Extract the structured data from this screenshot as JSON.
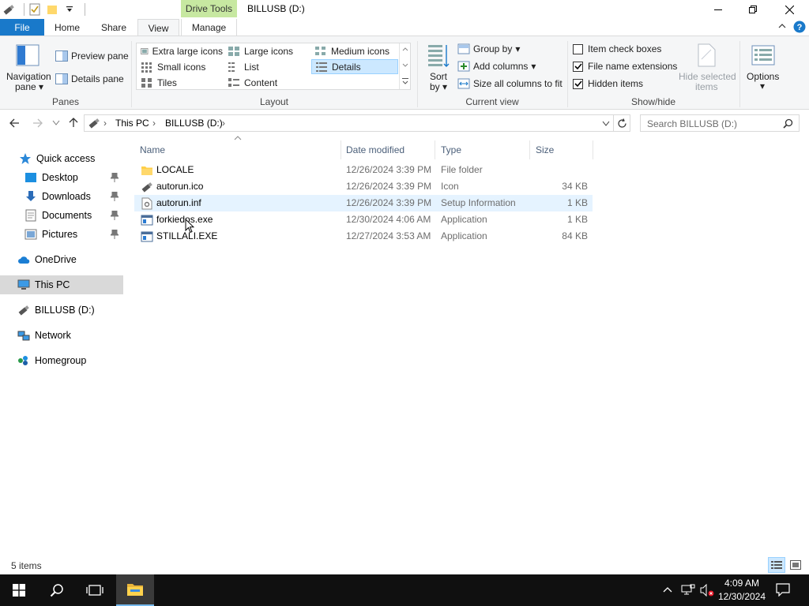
{
  "window": {
    "title": "BILLUSB (D:)",
    "context_tab_header": "Drive Tools"
  },
  "ribbon_tabs": [
    "File",
    "Home",
    "Share",
    "View",
    "Manage"
  ],
  "ribbon": {
    "panes": {
      "navigation_pane": "Navigation",
      "navigation_pane_2": "pane",
      "preview_pane": "Preview pane",
      "details_pane": "Details pane",
      "label": "Panes"
    },
    "layout": {
      "items": [
        "Extra large icons",
        "Large icons",
        "Medium icons",
        "Small icons",
        "List",
        "Details",
        "Tiles",
        "Content"
      ],
      "selected": "Details",
      "label": "Layout"
    },
    "current_view": {
      "sort_by": "Sort",
      "sort_by_2": "by",
      "group_by": "Group by",
      "add_columns": "Add columns",
      "size_columns": "Size all columns to fit",
      "label": "Current view"
    },
    "show_hide": {
      "item_check_boxes": "Item check boxes",
      "file_name_extensions": "File name extensions",
      "hidden_items": "Hidden items",
      "item_check_boxes_checked": false,
      "file_name_extensions_checked": true,
      "hidden_items_checked": true,
      "hide_selected": "Hide selected",
      "hide_selected_2": "items",
      "label": "Show/hide"
    },
    "options": "Options"
  },
  "address": {
    "crumbs": [
      "This PC",
      "BILLUSB (D:)"
    ],
    "search_placeholder": "Search BILLUSB (D:)"
  },
  "nav": {
    "quick_access": "Quick access",
    "desktop": "Desktop",
    "downloads": "Downloads",
    "documents": "Documents",
    "pictures": "Pictures",
    "onedrive": "OneDrive",
    "this_pc": "This PC",
    "billusb": "BILLUSB (D:)",
    "network": "Network",
    "homegroup": "Homegroup"
  },
  "columns": [
    "Name",
    "Date modified",
    "Type",
    "Size"
  ],
  "files": [
    {
      "name": "LOCALE",
      "date": "12/26/2024 3:39 PM",
      "type": "File folder",
      "size": "",
      "icon": "folder-icon"
    },
    {
      "name": "autorun.ico",
      "date": "12/26/2024 3:39 PM",
      "type": "Icon",
      "size": "34 KB",
      "icon": "usb-icon"
    },
    {
      "name": "autorun.inf",
      "date": "12/26/2024 3:39 PM",
      "type": "Setup Information",
      "size": "1 KB",
      "icon": "settings-file-icon"
    },
    {
      "name": "forkiedos.exe",
      "date": "12/30/2024 4:06 AM",
      "type": "Application",
      "size": "1 KB",
      "icon": "app-icon"
    },
    {
      "name": "STILLALI.EXE",
      "date": "12/27/2024 3:53 AM",
      "type": "Application",
      "size": "84 KB",
      "icon": "app-icon"
    }
  ],
  "status": {
    "items": "5 items"
  },
  "taskbar": {
    "time": "4:09 AM",
    "date": "12/30/2024"
  }
}
